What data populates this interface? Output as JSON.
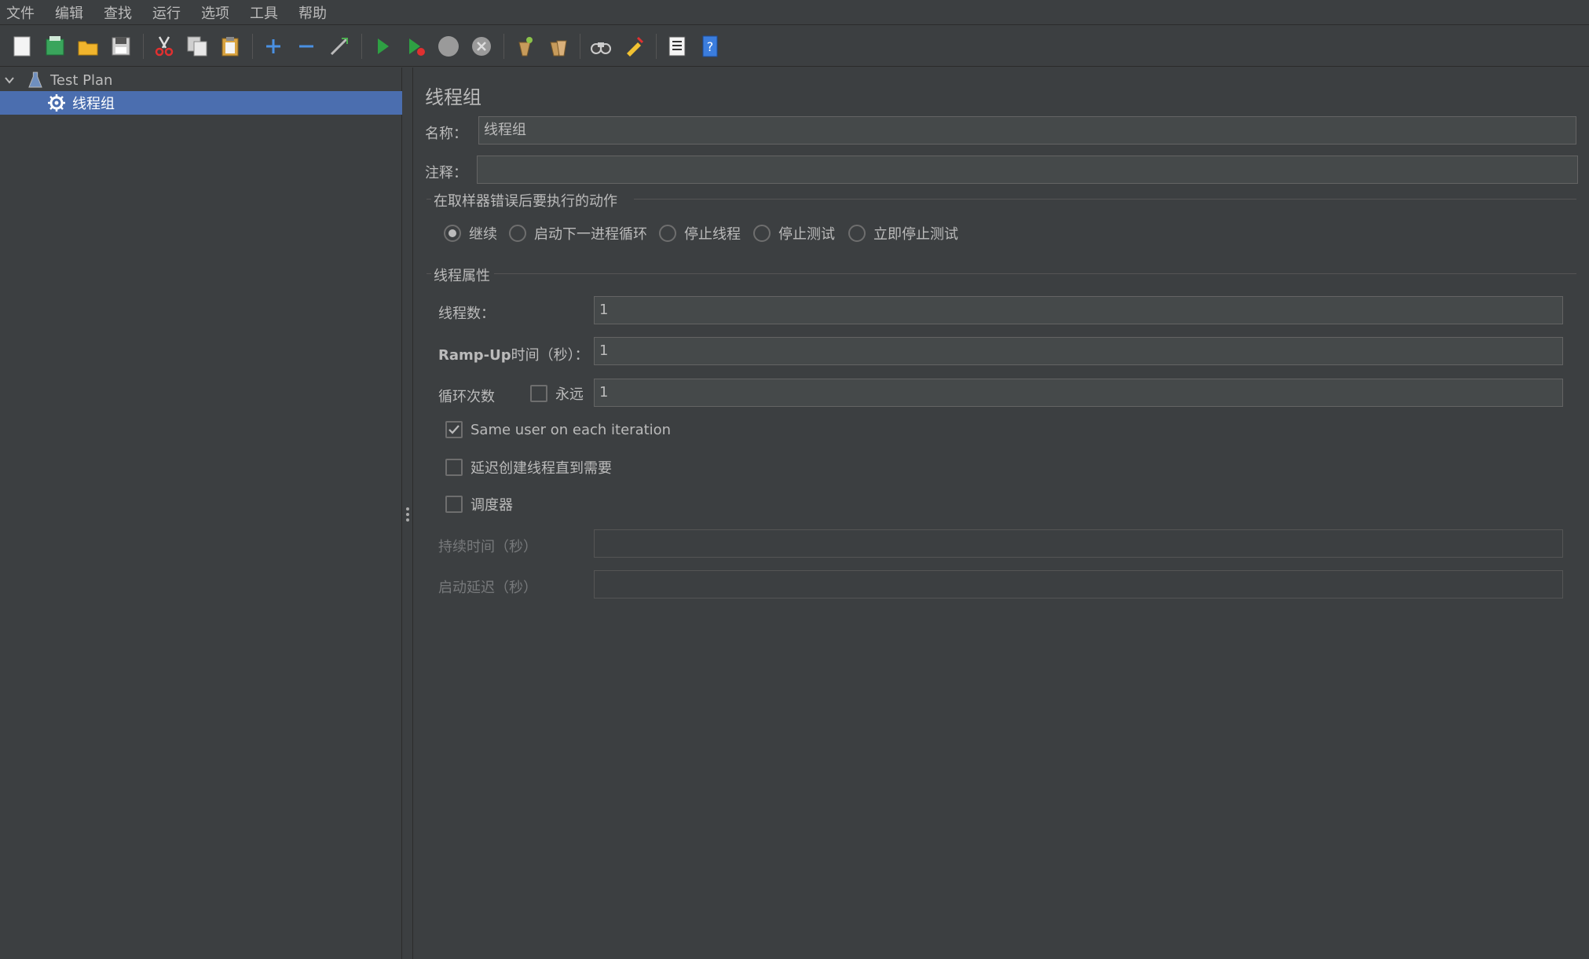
{
  "menu": [
    "文件",
    "编辑",
    "查找",
    "运行",
    "选项",
    "工具",
    "帮助"
  ],
  "toolbar": [
    {
      "icon": "new-icon"
    },
    {
      "icon": "templates-icon"
    },
    {
      "icon": "open-icon"
    },
    {
      "icon": "save-icon"
    },
    {
      "icon": "cut-icon"
    },
    {
      "icon": "copy-icon"
    },
    {
      "icon": "paste-icon"
    },
    {
      "icon": "expand-icon"
    },
    {
      "icon": "collapse-icon"
    },
    {
      "icon": "toggle-icon"
    },
    {
      "icon": "start-icon"
    },
    {
      "icon": "start-no-pause-icon"
    },
    {
      "icon": "stop-icon"
    },
    {
      "icon": "shutdown-icon"
    },
    {
      "icon": "clear-icon"
    },
    {
      "icon": "clear-all-icon"
    },
    {
      "icon": "search-icon"
    },
    {
      "icon": "reset-search-icon"
    },
    {
      "icon": "function-helper-icon"
    },
    {
      "icon": "help-icon"
    }
  ],
  "tree": {
    "root": "Test Plan",
    "child": "线程组"
  },
  "panel": {
    "title": "线程组",
    "name_label": "名称：",
    "name_value": "线程组",
    "comment_label": "注释：",
    "comment_value": "",
    "error_group_title": "在取样器错误后要执行的动作",
    "error_options": [
      "继续",
      "启动下一进程循环",
      "停止线程",
      "停止测试",
      "立即停止测试"
    ],
    "selected_error_option": "继续",
    "thread_group_title": "线程属性",
    "threads_label": "线程数：",
    "threads_value": "1",
    "rampup_label_en": "Ramp-Up",
    "rampup_label_cn": "时间（秒）：",
    "rampup_value": "1",
    "loop_label": "循环次数",
    "forever_label": "永远",
    "forever_checked": false,
    "loop_value": "1",
    "same_user_label": "Same user on each iteration",
    "same_user_checked": true,
    "delay_label": "延迟创建线程直到需要",
    "delay_checked": false,
    "scheduler_label": "调度器",
    "scheduler_checked": false,
    "duration_label": "持续时间（秒）",
    "duration_value": "",
    "startup_delay_label": "启动延迟（秒）",
    "startup_delay_value": ""
  }
}
